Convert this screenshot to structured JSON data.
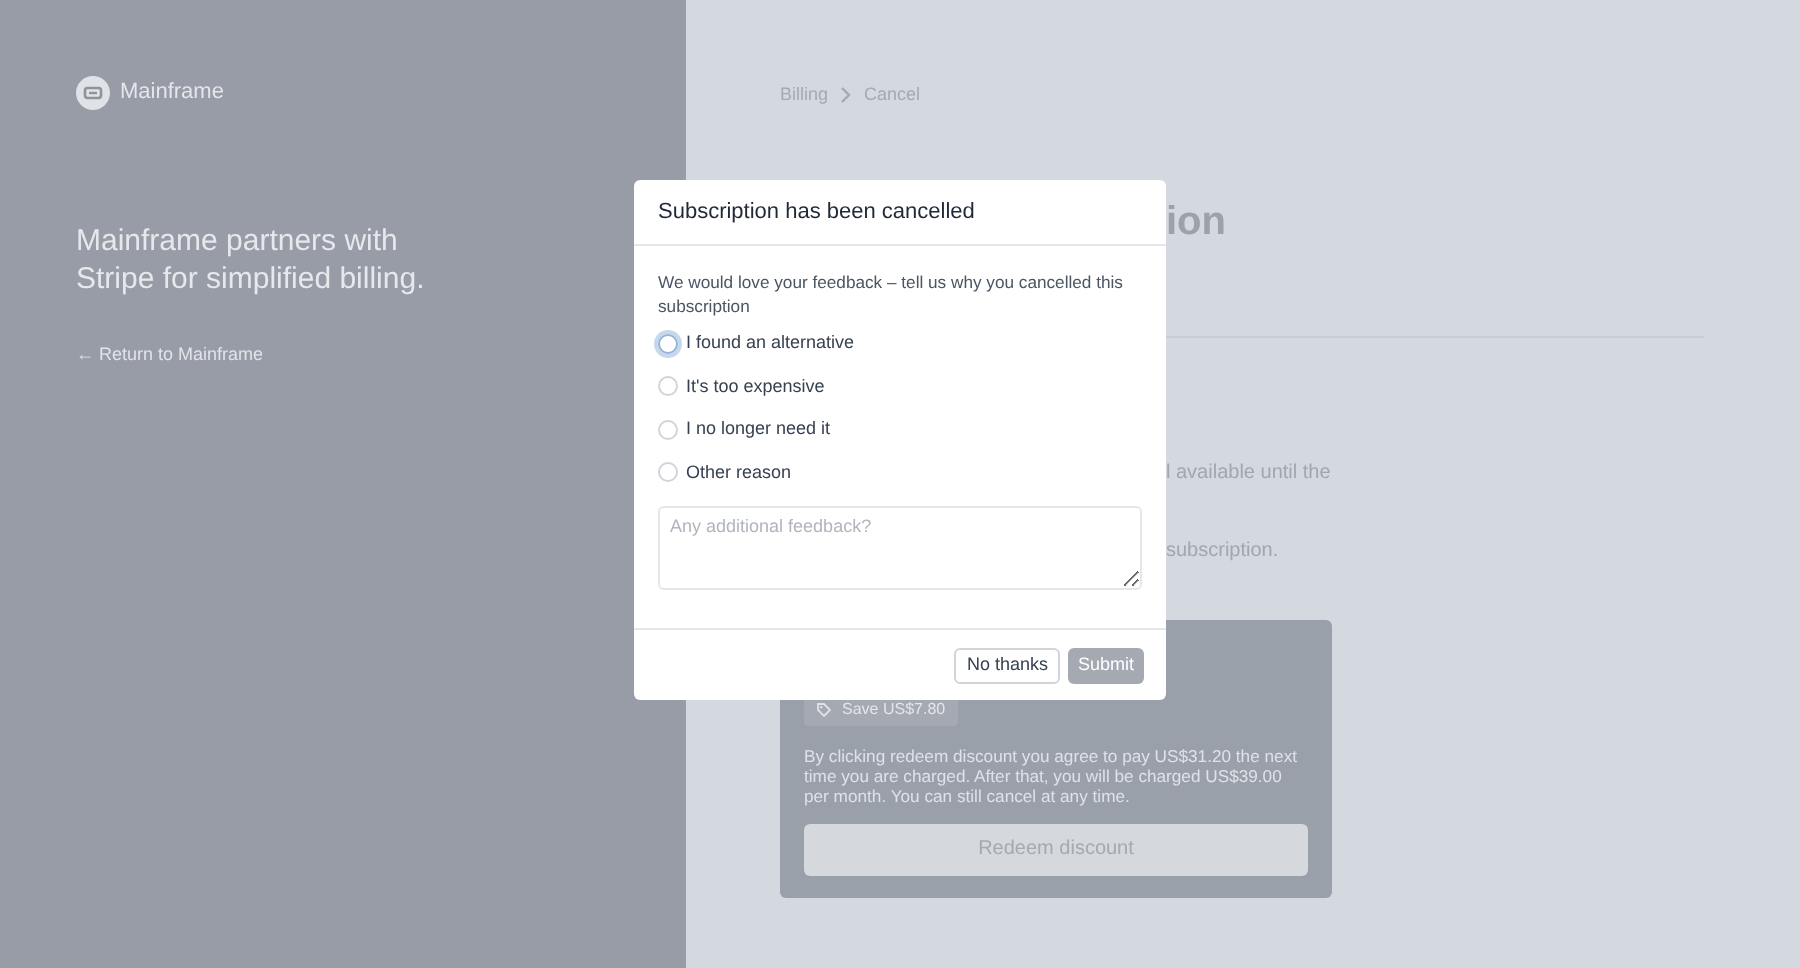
{
  "brand": {
    "name": "Mainframe"
  },
  "tagline": "Mainframe partners with Stripe for simplified billing.",
  "return_link": "← Return to Mainframe",
  "breadcrumb": [
    "Billing",
    "Cancel"
  ],
  "page_fragments": {
    "heading": "ion",
    "line_1": "l available until the",
    "line_2": "subscription."
  },
  "offer_card": {
    "tag": "Save US$7.80",
    "description": "By clicking redeem discount you agree to pay US$31.20 the next time you are charged. After that, you will be charged US$39.00 per month. You can still cancel at any time.",
    "button": "Redeem discount"
  },
  "dialog": {
    "title": "Subscription has been cancelled",
    "prompt": "We would love your feedback – tell us why you cancelled this subscription",
    "options": [
      {
        "label": "I found an alternative",
        "selected": false,
        "focused": true
      },
      {
        "label": "It's too expensive",
        "selected": false,
        "focused": false
      },
      {
        "label": "I no longer need it",
        "selected": false,
        "focused": false
      },
      {
        "label": "Other reason",
        "selected": false,
        "focused": false
      }
    ],
    "feedback": {
      "placeholder": "Any additional feedback?"
    },
    "buttons": [
      {
        "label": "No thanks",
        "kind": "secondary",
        "disabled": false
      },
      {
        "label": "Submit",
        "kind": "primary",
        "disabled": true
      }
    ]
  }
}
